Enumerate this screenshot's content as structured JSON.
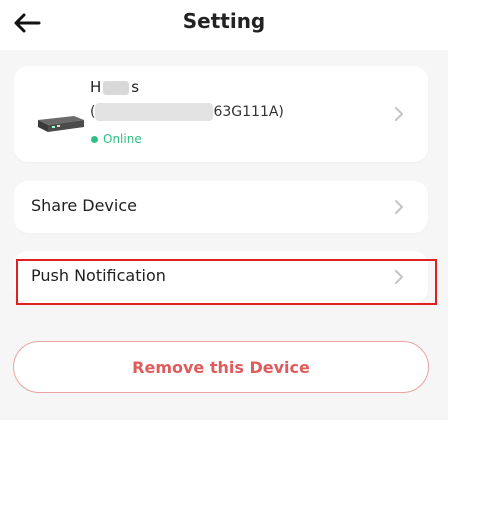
{
  "header": {
    "title": "Setting",
    "back_icon": "back-arrow-icon"
  },
  "device": {
    "name_prefix": "H",
    "name_suffix": "s",
    "id_prefix": "(",
    "id_suffix": "63G111A)",
    "status": "Online",
    "status_color": "#2fbf82"
  },
  "menu": {
    "share_label": "Share Device",
    "push_label": "Push Notification"
  },
  "actions": {
    "remove_label": "Remove this Device",
    "remove_color": "#e05b5b"
  },
  "highlight_color": "#e01f1f"
}
